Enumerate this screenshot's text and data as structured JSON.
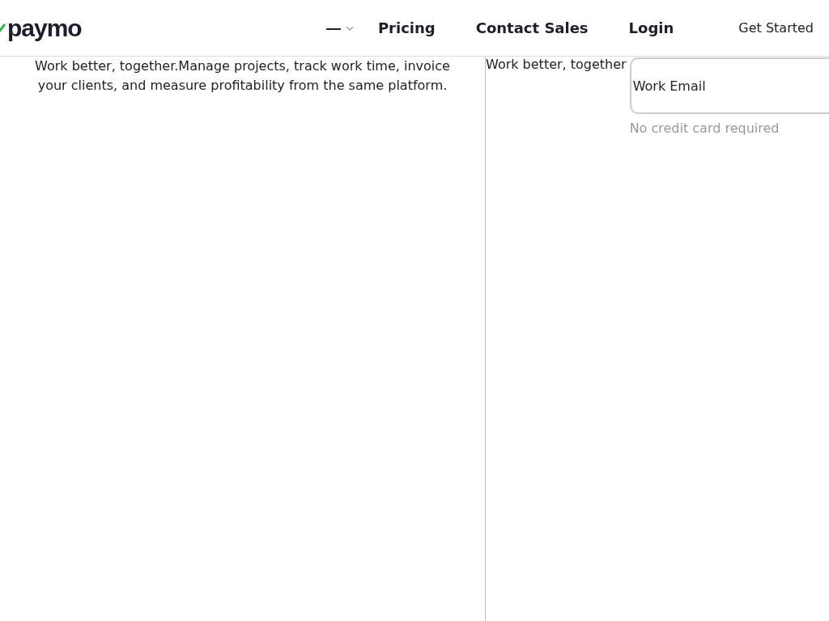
{
  "header": {
    "logo": "paymo",
    "nav": [
      {
        "label": "Pricing"
      },
      {
        "label": "Contact Sales"
      },
      {
        "label": "Login"
      }
    ],
    "cta": "Get Started"
  },
  "intro": {
    "text": "Work better, together.Manage projects, track work time, invoice your clients, and measure profitability from the same platform."
  },
  "signup": {
    "heading": "Work better, together",
    "email": {
      "placeholder": "Work Email"
    },
    "note": "No credit card required"
  }
}
